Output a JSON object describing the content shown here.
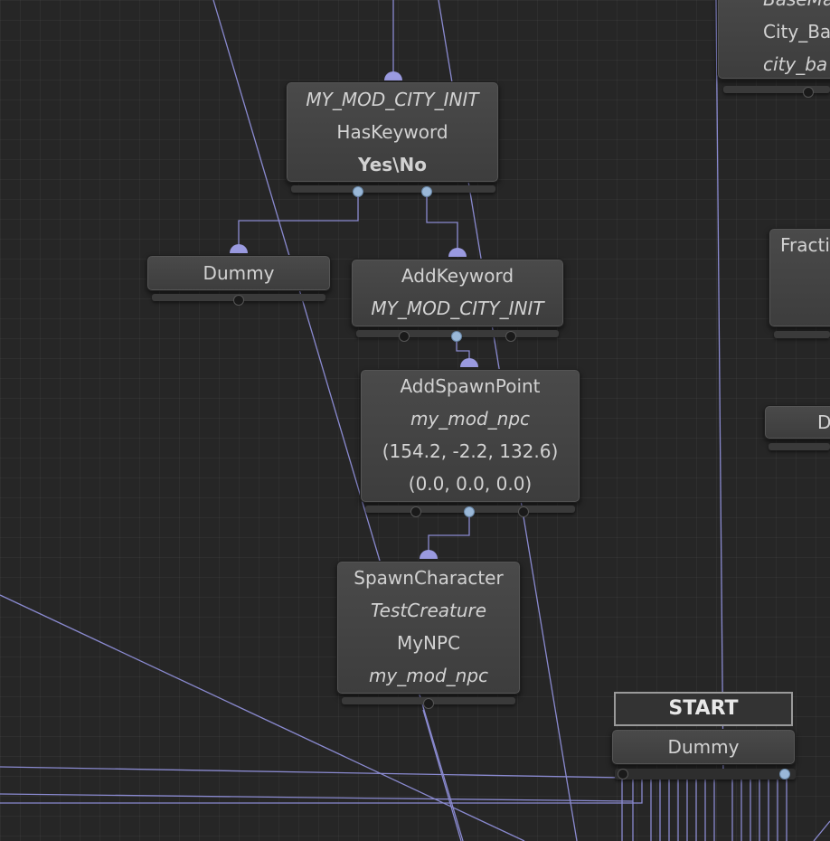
{
  "canvas": {
    "background": "#262626",
    "wire_color": "#8888cc",
    "active_wire": "#9a9ae0"
  },
  "nodes": {
    "haskeyword": {
      "lines": [
        "MY_MOD_CITY_INIT",
        "HasKeyword",
        "Yes\\No"
      ]
    },
    "dummy_left": {
      "lines": [
        "Dummy"
      ]
    },
    "addkeyword": {
      "lines": [
        "AddKeyword",
        "MY_MOD_CITY_INIT"
      ]
    },
    "addspawnpoint": {
      "lines": [
        "AddSpawnPoint",
        "my_mod_npc",
        "(154.2, -2.2, 132.6)",
        "(0.0, 0.0, 0.0)"
      ]
    },
    "spawncharacter": {
      "lines": [
        "SpawnCharacter",
        "TestCreature",
        "MyNPC",
        "my_mod_npc"
      ]
    },
    "start_dummy": {
      "lines": [
        "Dummy"
      ]
    },
    "top_right": {
      "lines": [
        "BaseMa",
        "City_Ba",
        "city_ba"
      ]
    },
    "fraction": {
      "lines": [
        "Fracti"
      ]
    },
    "right_d": {
      "lines": [
        "D"
      ]
    }
  },
  "start_label": "START"
}
